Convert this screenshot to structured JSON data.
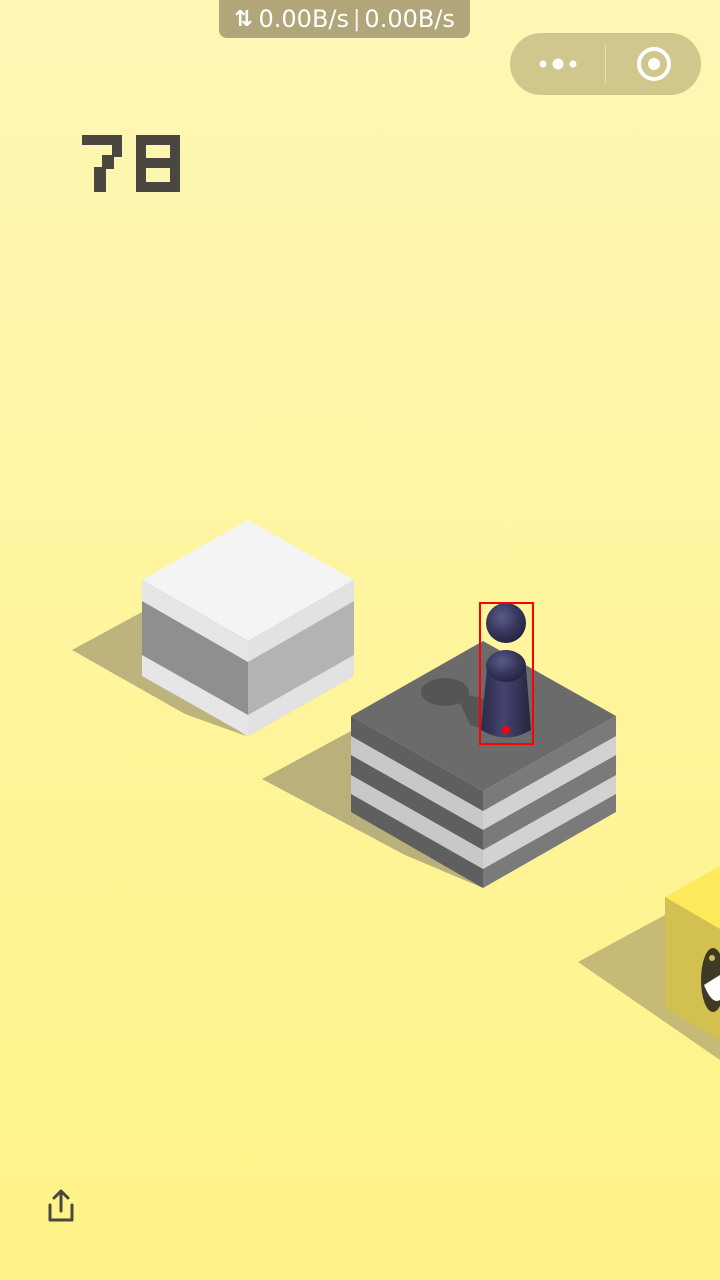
{
  "status_bar": {
    "upload_speed": "0.00B/s",
    "download_speed": "0.00B/s",
    "separator": "|",
    "arrows_icon": "data-transfer-arrows-icon"
  },
  "capsule": {
    "more_icon": "more-dots-icon",
    "close_icon": "circle-target-icon"
  },
  "game": {
    "score": "78",
    "score_color": "#4a4740",
    "background_top": "#fdf7b4",
    "background_bottom": "#fef283",
    "player_color": "#333355",
    "target_box_color": "#ff0000"
  },
  "footer": {
    "share_icon": "share-icon"
  }
}
